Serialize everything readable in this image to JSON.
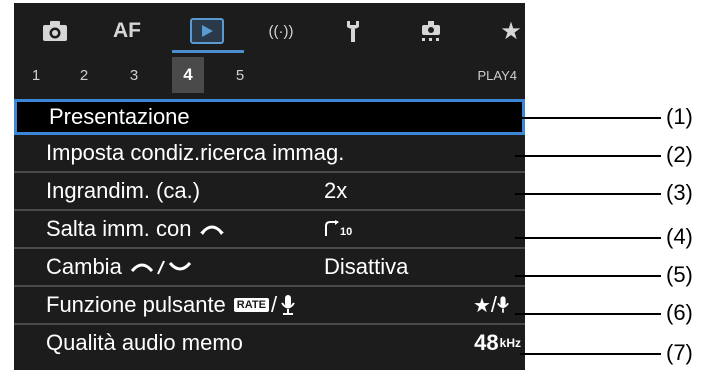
{
  "tabs": [
    {
      "label": "",
      "icon": "camera-icon"
    },
    {
      "label": "AF",
      "icon": ""
    },
    {
      "label": "",
      "icon": "playback-icon",
      "active": true
    },
    {
      "label": "",
      "icon": "wireless-icon"
    },
    {
      "label": "",
      "icon": "wrench-icon"
    },
    {
      "label": "",
      "icon": "custom-functions-icon"
    },
    {
      "label": "",
      "icon": "star-icon"
    }
  ],
  "subtabs": [
    "1",
    "2",
    "3",
    "4",
    "5"
  ],
  "active_subtab": "4",
  "page_label": "PLAY4",
  "menu": {
    "items": [
      {
        "label": "Presentazione",
        "value": "",
        "callout": "(1)",
        "selected": true
      },
      {
        "label": "Imposta condiz.ricerca immag.",
        "value": "",
        "callout": "(2)"
      },
      {
        "label": "Ingrandim. (ca.)",
        "value": "2x",
        "callout": "(3)"
      },
      {
        "label": "Salta imm. con",
        "value": "10",
        "callout": "(4)"
      },
      {
        "label": "Cambia",
        "value": "Disattiva",
        "callout": "(5)"
      },
      {
        "label": "Funzione pulsante",
        "badge": "RATE",
        "value": "",
        "callout": "(6)"
      },
      {
        "label": "Qualità audio memo",
        "value": "48",
        "unit": "kHz",
        "callout": "(7)"
      }
    ]
  },
  "colors": {
    "screen_bg": "#1c1c1c",
    "accent": "#3b86d6",
    "divider": "#4a4a4a"
  }
}
